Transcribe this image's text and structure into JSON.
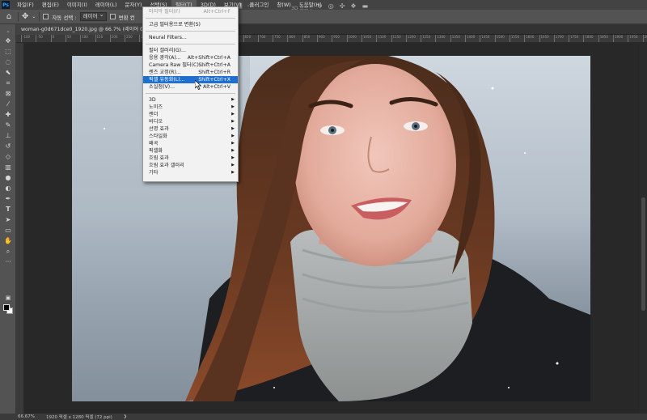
{
  "menubar": {
    "logo": "Ps",
    "items": [
      "파일(F)",
      "편집(E)",
      "이미지(I)",
      "레이어(L)",
      "문자(Y)",
      "선택(S)",
      "필터(T)",
      "3D(D)",
      "보기(V)",
      "플러그인",
      "창(W)",
      "도움말(H)"
    ],
    "active_index": 6
  },
  "options": {
    "auto_select_label": "자동 선택 :",
    "auto_select_value": "레이어",
    "transform_label": "변환 컨",
    "mode_3d": "3D 모드 :"
  },
  "document": {
    "tab_title": "woman-g0d671dce0_1920.jpg @ 66.7% (레이어 0, RGB/8)"
  },
  "ruler": {
    "ticks": [
      "-100",
      "-50",
      "0",
      "50",
      "100",
      "150",
      "200",
      "250",
      "300",
      "350",
      "400",
      "450",
      "500",
      "550",
      "600",
      "650",
      "700",
      "750",
      "800",
      "850",
      "900",
      "950",
      "1000",
      "1050",
      "1100",
      "1150",
      "1200",
      "1250",
      "1300",
      "1350",
      "1400",
      "1450",
      "1500",
      "1550",
      "1600",
      "1650",
      "1700",
      "1750",
      "1800",
      "1850",
      "1900",
      "1950",
      "2000"
    ]
  },
  "filter_menu": {
    "items": [
      {
        "label": "마지막 필터(F)",
        "shortcut": "Alt+Ctrl+F",
        "disabled": true
      },
      {
        "label": "고급 필터용으로 변환(S)",
        "shortcut": ""
      },
      {
        "label": "Neural Filters...",
        "shortcut": ""
      },
      {
        "label": "필터 갤러리(G)...",
        "shortcut": ""
      },
      {
        "label": "응용 광각(A)...",
        "shortcut": "Alt+Shift+Ctrl+A"
      },
      {
        "label": "Camera Raw 필터(C)...",
        "shortcut": "Shift+Ctrl+A"
      },
      {
        "label": "렌즈 교정(R)...",
        "shortcut": "Shift+Ctrl+R"
      },
      {
        "label": "픽셀 유동화(L)...",
        "shortcut": "Shift+Ctrl+X",
        "highlighted": true
      },
      {
        "label": "소실점(V)...",
        "shortcut": "Alt+Ctrl+V"
      },
      {
        "label": "3D",
        "submenu": true
      },
      {
        "label": "노이즈",
        "submenu": true
      },
      {
        "label": "렌더",
        "submenu": true
      },
      {
        "label": "비디오",
        "submenu": true
      },
      {
        "label": "선명 효과",
        "submenu": true
      },
      {
        "label": "스타일화",
        "submenu": true
      },
      {
        "label": "왜곡",
        "submenu": true
      },
      {
        "label": "픽셀화",
        "submenu": true
      },
      {
        "label": "흐림 효과",
        "submenu": true
      },
      {
        "label": "흐림 효과 갤러리",
        "submenu": true
      },
      {
        "label": "기타",
        "submenu": true
      }
    ]
  },
  "status": {
    "zoom": "66.67%",
    "dimensions": "1920 픽셀 x 1280 픽셀 (72 ppi)"
  }
}
